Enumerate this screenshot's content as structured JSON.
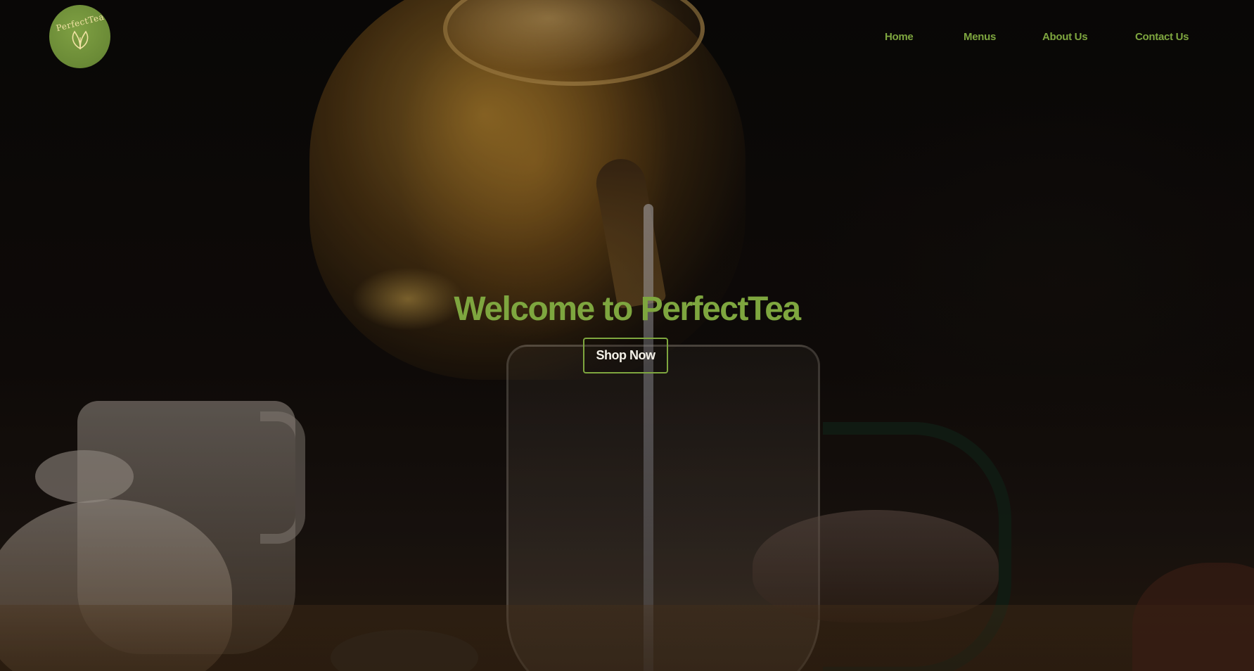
{
  "brand": {
    "logo_text": "PerfectTea",
    "accent_color": "#7ea63f",
    "logo_color": "#6a8a36"
  },
  "nav": {
    "items": [
      {
        "label": "Home"
      },
      {
        "label": "Menus"
      },
      {
        "label": "About Us"
      },
      {
        "label": "Contact Us"
      }
    ]
  },
  "hero": {
    "title": "Welcome to PerfectTea",
    "cta_label": "Shop Now",
    "background_icon": "teapot-pouring-photo"
  }
}
